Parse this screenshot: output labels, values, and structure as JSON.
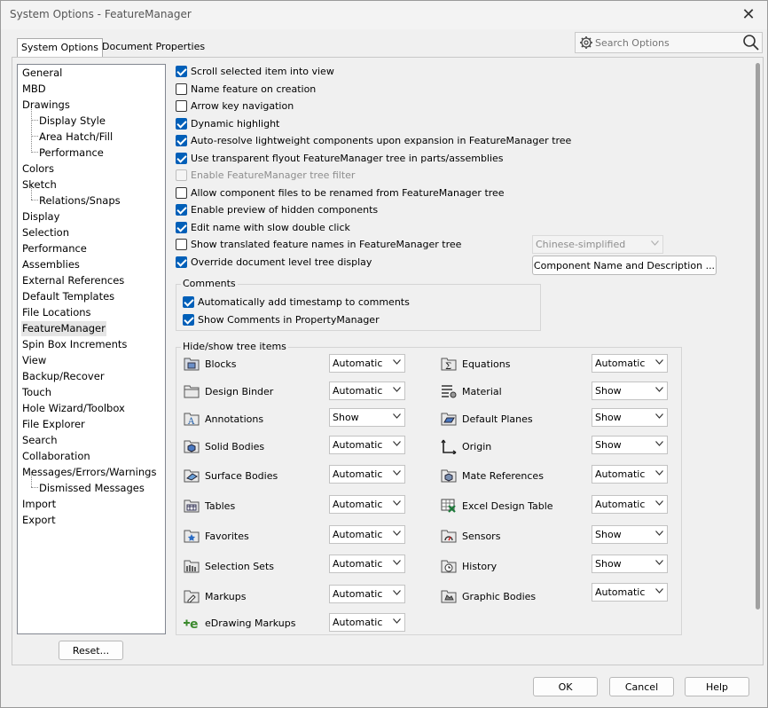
{
  "window": {
    "title": "System Options - FeatureManager"
  },
  "tabs": [
    "System Options",
    "Document Properties"
  ],
  "search": {
    "placeholder": "Search Options",
    "value": ""
  },
  "tree": [
    {
      "label": "General"
    },
    {
      "label": "MBD"
    },
    {
      "label": "Drawings"
    },
    {
      "label": "Display Style"
    },
    {
      "label": "Area Hatch/Fill"
    },
    {
      "label": "Performance"
    },
    {
      "label": "Colors"
    },
    {
      "label": "Sketch"
    },
    {
      "label": "Relations/Snaps"
    },
    {
      "label": "Display"
    },
    {
      "label": "Selection"
    },
    {
      "label": "Performance"
    },
    {
      "label": "Assemblies"
    },
    {
      "label": "External References"
    },
    {
      "label": "Default Templates"
    },
    {
      "label": "File Locations"
    },
    {
      "label": "FeatureManager"
    },
    {
      "label": "Spin Box Increments"
    },
    {
      "label": "View"
    },
    {
      "label": "Backup/Recover"
    },
    {
      "label": "Touch"
    },
    {
      "label": "Hole Wizard/Toolbox"
    },
    {
      "label": "File Explorer"
    },
    {
      "label": "Search"
    },
    {
      "label": "Collaboration"
    },
    {
      "label": "Messages/Errors/Warnings"
    },
    {
      "label": "Dismissed Messages"
    },
    {
      "label": "Import"
    },
    {
      "label": "Export"
    }
  ],
  "reset_label": "Reset...",
  "options": [
    {
      "label": "Scroll selected item into view",
      "checked": true,
      "enabled": true
    },
    {
      "label": "Name feature on creation",
      "checked": false,
      "enabled": true
    },
    {
      "label": "Arrow key navigation",
      "checked": false,
      "enabled": true
    },
    {
      "label": "Dynamic highlight",
      "checked": true,
      "enabled": true
    },
    {
      "label": "Auto-resolve lightweight components upon expansion in FeatureManager tree",
      "checked": true,
      "enabled": true
    },
    {
      "label": "Use transparent flyout FeatureManager tree in parts/assemblies",
      "checked": true,
      "enabled": true
    },
    {
      "label": "Enable FeatureManager tree filter",
      "checked": false,
      "enabled": false
    },
    {
      "label": "Allow component files to be renamed from FeatureManager tree",
      "checked": false,
      "enabled": true
    },
    {
      "label": "Enable preview of hidden components",
      "checked": true,
      "enabled": true
    },
    {
      "label": "Edit name with slow double click",
      "checked": true,
      "enabled": true
    },
    {
      "label": "Show translated feature names in FeatureManager tree",
      "checked": false,
      "enabled": true
    },
    {
      "label": "Override document level tree display",
      "checked": true,
      "enabled": true
    }
  ],
  "language_select": {
    "value": "Chinese-simplified",
    "enabled": false
  },
  "component_button": "Component Name and Description ...",
  "comments": {
    "title": "Comments",
    "items": [
      {
        "label": "Automatically add timestamp to comments",
        "checked": true
      },
      {
        "label": "Show Comments in PropertyManager",
        "checked": true
      }
    ]
  },
  "hide_show": {
    "title": "Hide/show tree items",
    "left": [
      {
        "label": "Blocks",
        "value": "Automatic",
        "icon": "blocks-icon"
      },
      {
        "label": "Design Binder",
        "value": "Automatic",
        "icon": "design-binder-icon"
      },
      {
        "label": "Annotations",
        "value": "Show",
        "icon": "annotations-icon"
      },
      {
        "label": "Solid Bodies",
        "value": "Automatic",
        "icon": "solid-bodies-icon"
      },
      {
        "label": "Surface Bodies",
        "value": "Automatic",
        "icon": "surface-bodies-icon"
      },
      {
        "label": "Tables",
        "value": "Automatic",
        "icon": "tables-icon"
      },
      {
        "label": "Favorites",
        "value": "Automatic",
        "icon": "favorites-icon"
      },
      {
        "label": "Selection Sets",
        "value": "Automatic",
        "icon": "selection-sets-icon"
      },
      {
        "label": "Markups",
        "value": "Automatic",
        "icon": "markups-icon"
      },
      {
        "label": "eDrawing Markups",
        "value": "Automatic",
        "icon": "edrawing-markups-icon"
      }
    ],
    "right": [
      {
        "label": "Equations",
        "value": "Automatic",
        "icon": "equations-icon"
      },
      {
        "label": "Material",
        "value": "Show",
        "icon": "material-icon"
      },
      {
        "label": "Default Planes",
        "value": "Show",
        "icon": "default-planes-icon"
      },
      {
        "label": "Origin",
        "value": "Show",
        "icon": "origin-icon"
      },
      {
        "label": "Mate References",
        "value": "Automatic",
        "icon": "mate-references-icon"
      },
      {
        "label": "Excel Design Table",
        "value": "Automatic",
        "icon": "excel-design-table-icon"
      },
      {
        "label": "Sensors",
        "value": "Show",
        "icon": "sensors-icon"
      },
      {
        "label": "History",
        "value": "Show",
        "icon": "history-icon"
      },
      {
        "label": "Graphic Bodies",
        "value": "Automatic",
        "icon": "graphic-bodies-icon"
      }
    ]
  },
  "footer": {
    "ok": "OK",
    "cancel": "Cancel",
    "help": "Help"
  },
  "colors": {
    "accent": "#005fb8",
    "selected_item": "#e5e5e5"
  }
}
